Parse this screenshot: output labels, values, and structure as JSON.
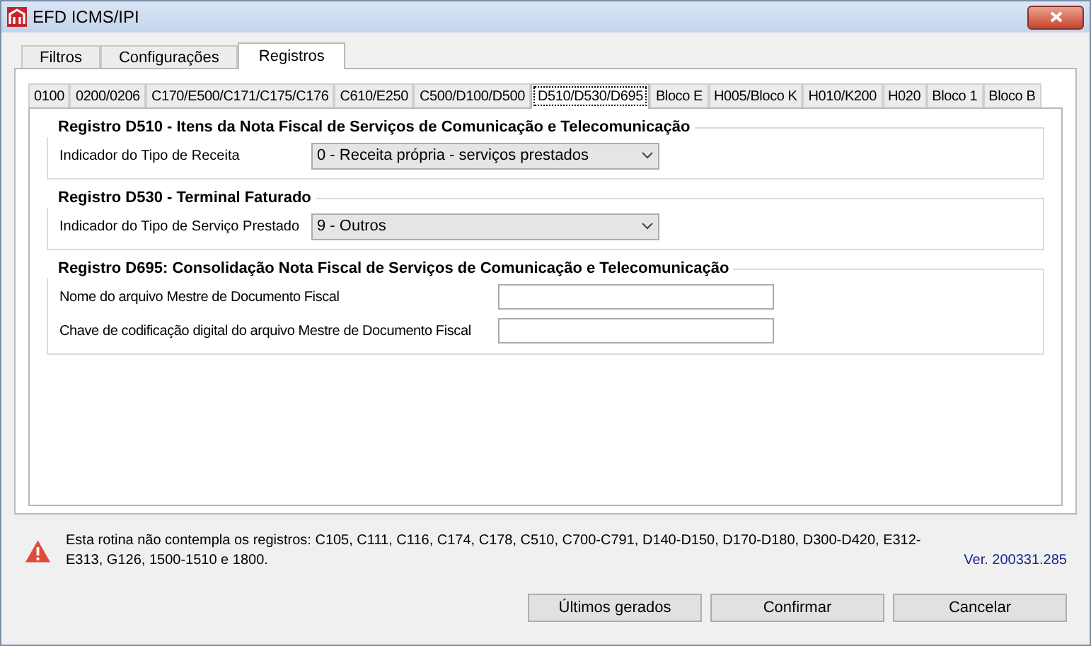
{
  "window": {
    "title": "EFD ICMS/IPI"
  },
  "tabs": [
    {
      "label": "Filtros",
      "selected": false
    },
    {
      "label": "Configurações",
      "selected": false
    },
    {
      "label": "Registros",
      "selected": true
    }
  ],
  "subtabs": [
    {
      "label": "0100",
      "selected": false
    },
    {
      "label": "0200/0206",
      "selected": false
    },
    {
      "label": "C170/E500/C171/C175/C176",
      "selected": false
    },
    {
      "label": "C610/E250",
      "selected": false
    },
    {
      "label": "C500/D100/D500",
      "selected": false
    },
    {
      "label": "D510/D530/D695",
      "selected": true
    },
    {
      "label": "Bloco E",
      "selected": false
    },
    {
      "label": "H005/Bloco K",
      "selected": false
    },
    {
      "label": "H010/K200",
      "selected": false
    },
    {
      "label": "H020",
      "selected": false
    },
    {
      "label": "Bloco 1",
      "selected": false
    },
    {
      "label": "Bloco B",
      "selected": false
    }
  ],
  "groups": [
    {
      "title": "Registro D510 - Itens da Nota Fiscal de Serviços de Comunicação e Telecomunicação",
      "fields": [
        {
          "kind": "select",
          "label": "Indicador do Tipo de Receita",
          "value": "0 - Receita própria - serviços prestados"
        }
      ]
    },
    {
      "title": "Registro D530 - Terminal Faturado",
      "fields": [
        {
          "kind": "select",
          "label": "Indicador do Tipo de Serviço Prestado",
          "value": "9 - Outros"
        }
      ]
    },
    {
      "title": "Registro D695: Consolidação Nota Fiscal de Serviços de Comunicação e Telecomunicação",
      "fields": [
        {
          "kind": "text",
          "label": "Nome do arquivo Mestre de Documento Fiscal"
        },
        {
          "kind": "text",
          "label": "Chave de codificação digital do arquivo Mestre de Documento Fiscal"
        }
      ]
    }
  ],
  "warning": "Esta rotina não contempla os registros: C105, C111, C116, C174, C178, C510, C700-C791, D140-D150, D170-D180, D300-D420, E312-E313, G126, 1500-1510 e 1800.",
  "version": "Ver. 200331.285",
  "buttons": [
    "Últimos gerados",
    "Confirmar",
    "Cancelar"
  ]
}
